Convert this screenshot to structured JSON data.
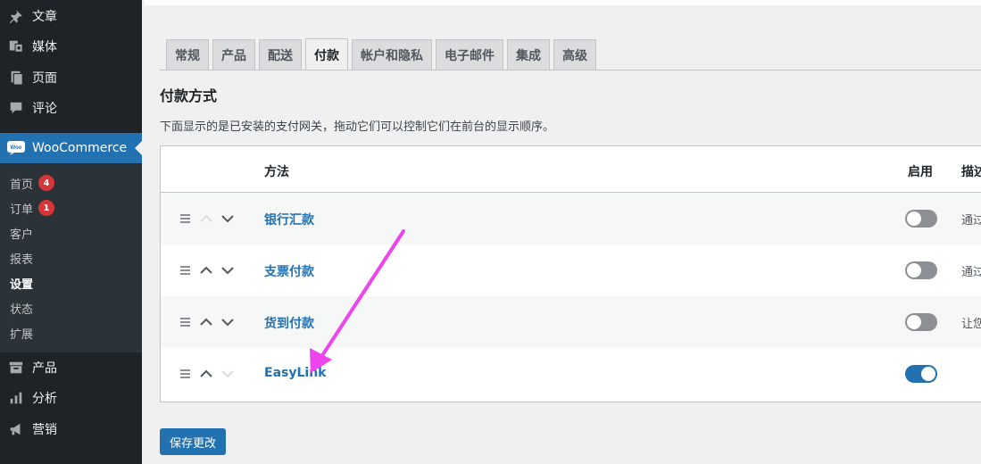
{
  "sidebar": {
    "top_items": [
      {
        "label": "文章",
        "icon": "pin-icon"
      },
      {
        "label": "媒体",
        "icon": "media-icon"
      },
      {
        "label": "页面",
        "icon": "page-icon"
      },
      {
        "label": "评论",
        "icon": "comment-icon"
      }
    ],
    "woocommerce": {
      "label": "WooCommerce",
      "icon": "woo-icon",
      "icon_text": "Woo"
    },
    "submenu": [
      {
        "label": "首页",
        "badge": "4"
      },
      {
        "label": "订单",
        "badge": "1"
      },
      {
        "label": "客户"
      },
      {
        "label": "报表"
      },
      {
        "label": "设置",
        "current": true
      },
      {
        "label": "状态"
      },
      {
        "label": "扩展"
      }
    ],
    "bottom_items": [
      {
        "label": "产品",
        "icon": "archive-icon"
      },
      {
        "label": "分析",
        "icon": "bar-chart-icon"
      },
      {
        "label": "营销",
        "icon": "megaphone-icon"
      }
    ]
  },
  "tabs": [
    {
      "label": "常规"
    },
    {
      "label": "产品"
    },
    {
      "label": "配送"
    },
    {
      "label": "付款",
      "active": true
    },
    {
      "label": "帐户和隐私"
    },
    {
      "label": "电子邮件"
    },
    {
      "label": "集成"
    },
    {
      "label": "高级"
    }
  ],
  "section": {
    "title": "付款方式",
    "description": "下面显示的是已安装的支付网关，拖动它们可以控制它们在前台的显示顺序。"
  },
  "table": {
    "headers": {
      "method": "方法",
      "enabled": "启用",
      "description": "描述"
    },
    "rows": [
      {
        "name": "银行汇款",
        "enabled": false,
        "description": "通过"
      },
      {
        "name": "支票付款",
        "enabled": false,
        "description": "通过"
      },
      {
        "name": "货到付款",
        "enabled": false,
        "description": "让您"
      },
      {
        "name": "EasyLink",
        "enabled": true,
        "description": ""
      }
    ]
  },
  "save_button": "保存更改",
  "colors": {
    "sidebar_bg": "#1d2327",
    "accent": "#2271b1",
    "badge": "#d63638",
    "annotation_arrow": "#ee44ee"
  }
}
